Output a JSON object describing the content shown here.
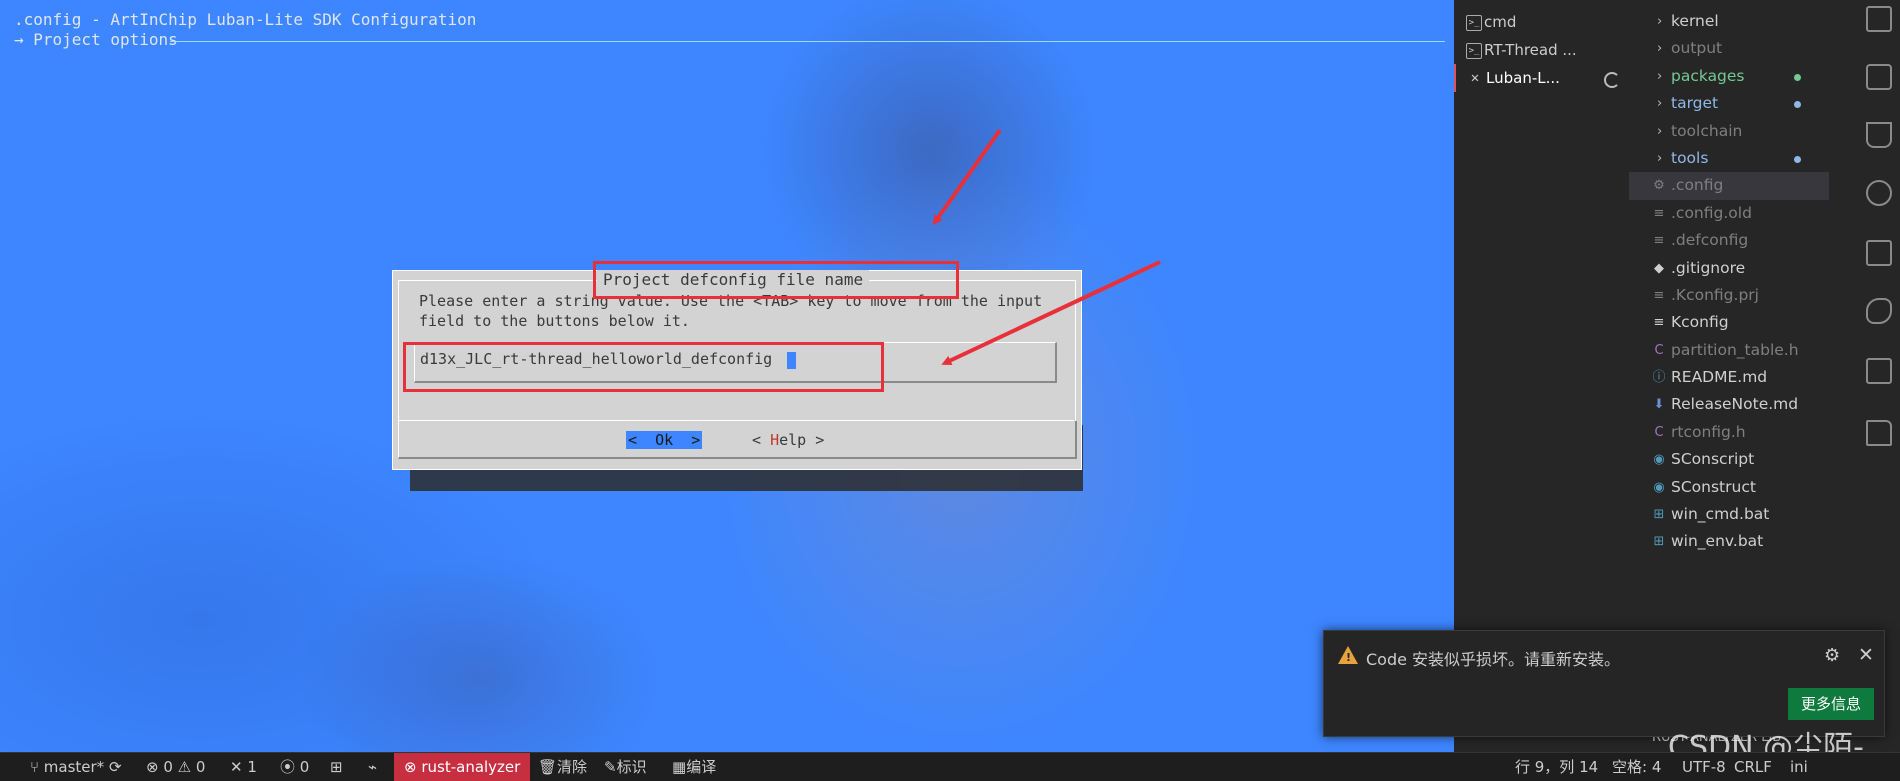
{
  "terminal": {
    "title_line": ".config - ArtInChip Luban-Lite SDK Configuration",
    "breadcrumb": "→ Project options"
  },
  "dialog": {
    "title": "Project defconfig file name",
    "prompt_line1": "Please enter a string value. Use the <TAB> key to move from the input",
    "prompt_line2": "field to the buttons below it.",
    "input_value": "d13x_JLC_rt-thread_helloworld_defconfig",
    "ok_label": "<  Ok  >",
    "help_prefix": "< ",
    "help_hot": "H",
    "help_rest": "elp >"
  },
  "terminals": [
    {
      "label": "cmd",
      "icon": ">_"
    },
    {
      "label": "RT-Thread ...",
      "icon": ">_"
    },
    {
      "label": "Luban-L...",
      "icon": "tools-icon",
      "active": true
    }
  ],
  "explorer": [
    {
      "label": "kernel",
      "kind": "folder",
      "style": "normal"
    },
    {
      "label": "output",
      "kind": "folder",
      "style": "dim"
    },
    {
      "label": "packages",
      "kind": "folder",
      "style": "green",
      "dot": "#73c991"
    },
    {
      "label": "target",
      "kind": "folder",
      "style": "blue",
      "dot": "#8fb8e8"
    },
    {
      "label": "toolchain",
      "kind": "folder",
      "style": "dim"
    },
    {
      "label": "tools",
      "kind": "folder",
      "style": "blue",
      "dot": "#8fb8e8"
    },
    {
      "label": ".config",
      "kind": "file",
      "icon": "⚙",
      "style": "dim",
      "selected": true
    },
    {
      "label": ".config.old",
      "kind": "file",
      "icon": "≡",
      "style": "dim"
    },
    {
      "label": ".defconfig",
      "kind": "file",
      "icon": "≡",
      "style": "dim"
    },
    {
      "label": ".gitignore",
      "kind": "file",
      "icon": "◆",
      "style": "normal"
    },
    {
      "label": ".Kconfig.prj",
      "kind": "file",
      "icon": "≡",
      "style": "dim"
    },
    {
      "label": "Kconfig",
      "kind": "file",
      "icon": "≡",
      "style": "normal"
    },
    {
      "label": "partition_table.h",
      "kind": "file",
      "icon": "C",
      "style": "dim"
    },
    {
      "label": "README.md",
      "kind": "file",
      "icon": "ⓘ",
      "style": "normal"
    },
    {
      "label": "ReleaseNote.md",
      "kind": "file",
      "icon": "⬇",
      "style": "normal"
    },
    {
      "label": "rtconfig.h",
      "kind": "file",
      "icon": "C",
      "style": "dim"
    },
    {
      "label": "SConscript",
      "kind": "file",
      "icon": "◉",
      "style": "normal"
    },
    {
      "label": "SConstruct",
      "kind": "file",
      "icon": "◉",
      "style": "normal"
    },
    {
      "label": "win_cmd.bat",
      "kind": "file",
      "icon": "⊞",
      "style": "normal"
    },
    {
      "label": "win_env.bat",
      "kind": "file",
      "icon": "⊞",
      "style": "normal"
    }
  ],
  "notification": {
    "message": "Code 安装似乎损坏。请重新安装。",
    "button": "更多信息"
  },
  "behind_text": "RUST-ANALYZER LIB",
  "watermark": "CSDN @尘陌-",
  "status": {
    "branch": "master*",
    "errors": "0",
    "warnings": "0",
    "tools": "1",
    "ports": "0",
    "rust_analyzer": "rust-analyzer",
    "clear": "清除",
    "mark": "标识",
    "compile": "编译",
    "position": "行 9，列 14",
    "spaces": "空格: 4",
    "encoding": "UTF-8",
    "eol": "CRLF",
    "lang": "ini"
  },
  "colors": {
    "terminal_bg": "#3d86ff",
    "dialog_bg": "#d3d3d3",
    "annotation": "#e8303a",
    "notif_button": "#0e7a3d",
    "rust_analyzer_bg": "#c72e3f"
  }
}
